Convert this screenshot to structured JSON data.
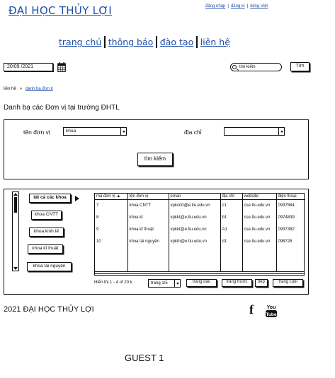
{
  "header": {
    "site_title": "ĐẠI HỌC THỦY LỢI",
    "links": [
      "đăng nhập",
      "đăng kí",
      "tiếng Việt"
    ]
  },
  "nav": {
    "items": [
      "trang chủ",
      "thông báo",
      "đào tạo",
      "liên hệ"
    ]
  },
  "toolbar": {
    "date": "20/09 /2021",
    "search_placeholder": "tìm kiếm",
    "search_button": "Tìm"
  },
  "breadcrumb": {
    "root": "liên hệ",
    "sep": "»",
    "current": "danh bạ đơn tị"
  },
  "page_heading": "Danh bạ các Đơn vị tại trường ĐHTL",
  "filter": {
    "unit_label": "tên đơn vị",
    "unit_value": "khoa",
    "address_label": "địa chỉ",
    "address_value": "",
    "find_button": "tìm kiếm"
  },
  "categories": [
    "tất cả các khoa",
    "khoa CNTT",
    "khoa kinh tế",
    "khoa kĩ thuật",
    "khoa tài nguyên"
  ],
  "table": {
    "columns": [
      "mã đơn vị ▲",
      "tên đơn vị",
      "email",
      "địa chỉ",
      "website",
      "điện thoại"
    ],
    "rows": [
      [
        "7",
        "khoa CNTT",
        "vpkcntt@e.tlu.edu.vn",
        "c1",
        "cse.tlu.edu.vn",
        "0937584"
      ],
      [
        "8",
        "khoa kt",
        "vpkkt@e.tlu.edu.vn",
        "b1",
        "cse.tlu.edu.vn",
        "0974839"
      ],
      [
        "9",
        "khoa kĩ thuật",
        "vpkkt@e.tlu.edu.vn",
        "A1",
        "cse.tlu.edu.vn",
        "0937382"
      ],
      [
        "10",
        "khoa tài nguyên",
        "vpktn@e.tlu.edu.vn",
        "d1",
        "cse.tlu.edu.vn",
        "098728"
      ]
    ]
  },
  "pager": {
    "info": "Hiển thị 1 - 4 of 20 k",
    "page_select": "trang 1/5",
    "first": "trang đầu",
    "prev": "trang trước",
    "next": "tiếp",
    "last": "trang cuối"
  },
  "footer": {
    "text": "2021 ĐẠI HỌC THỦY LỢI",
    "facebook": "f",
    "youtube_top": "You",
    "youtube_bottom": "Tube"
  },
  "user_label": "GUEST 1"
}
